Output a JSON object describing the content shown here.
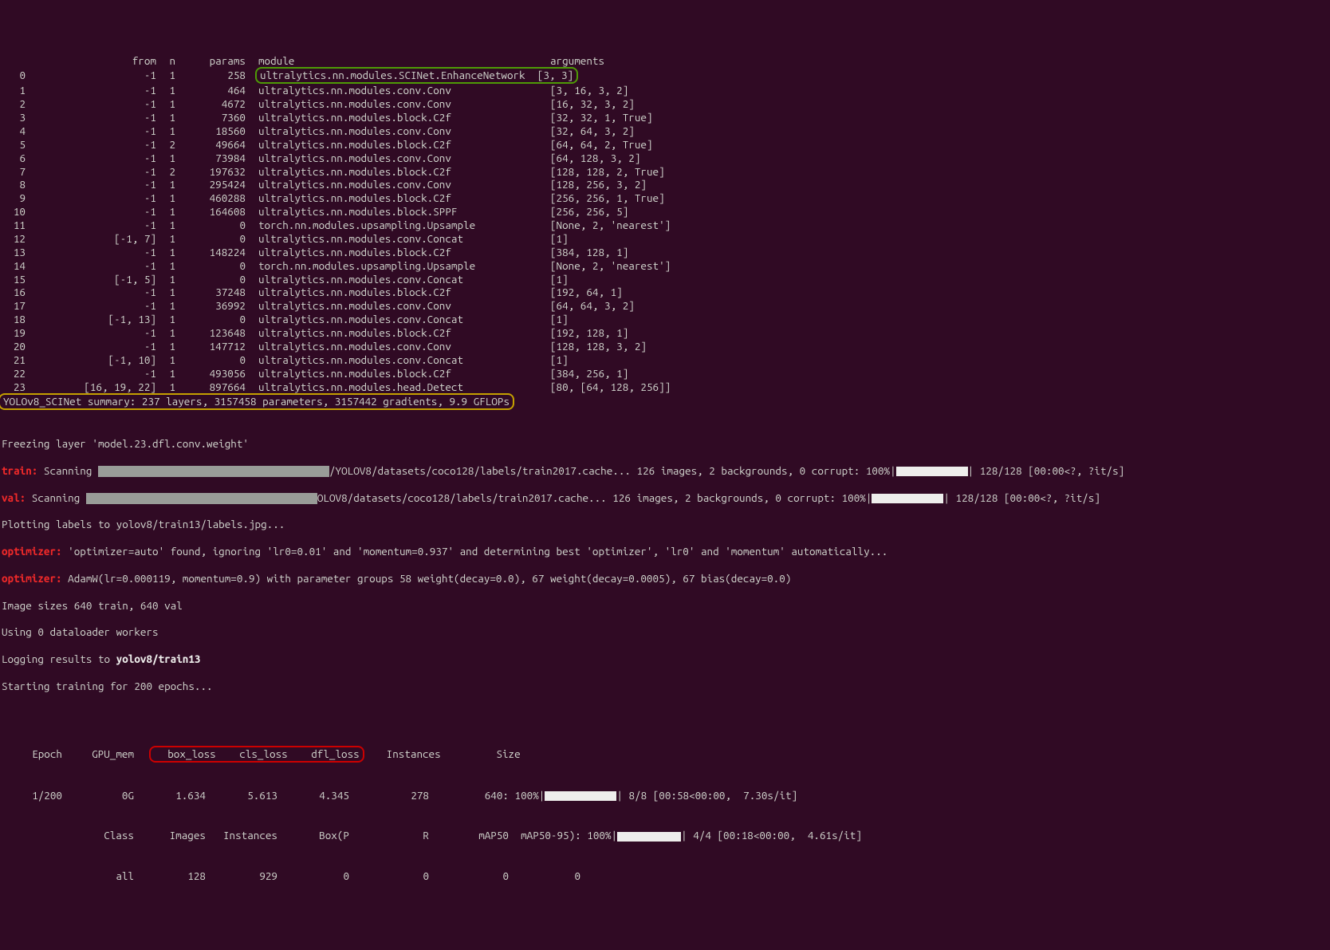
{
  "headers": {
    "from": "from",
    "n": "n",
    "params": "params",
    "module": "module",
    "arguments": "arguments"
  },
  "rows": [
    {
      "idx": "0",
      "from": "-1",
      "n": "1",
      "params": "258",
      "module": "ultralytics.nn.modules.SCINet.EnhanceNetwork",
      "args": "[3, 3]",
      "hl": "green"
    },
    {
      "idx": "1",
      "from": "-1",
      "n": "1",
      "params": "464",
      "module": "ultralytics.nn.modules.conv.Conv",
      "args": "[3, 16, 3, 2]"
    },
    {
      "idx": "2",
      "from": "-1",
      "n": "1",
      "params": "4672",
      "module": "ultralytics.nn.modules.conv.Conv",
      "args": "[16, 32, 3, 2]"
    },
    {
      "idx": "3",
      "from": "-1",
      "n": "1",
      "params": "7360",
      "module": "ultralytics.nn.modules.block.C2f",
      "args": "[32, 32, 1, True]"
    },
    {
      "idx": "4",
      "from": "-1",
      "n": "1",
      "params": "18560",
      "module": "ultralytics.nn.modules.conv.Conv",
      "args": "[32, 64, 3, 2]"
    },
    {
      "idx": "5",
      "from": "-1",
      "n": "2",
      "params": "49664",
      "module": "ultralytics.nn.modules.block.C2f",
      "args": "[64, 64, 2, True]"
    },
    {
      "idx": "6",
      "from": "-1",
      "n": "1",
      "params": "73984",
      "module": "ultralytics.nn.modules.conv.Conv",
      "args": "[64, 128, 3, 2]"
    },
    {
      "idx": "7",
      "from": "-1",
      "n": "2",
      "params": "197632",
      "module": "ultralytics.nn.modules.block.C2f",
      "args": "[128, 128, 2, True]"
    },
    {
      "idx": "8",
      "from": "-1",
      "n": "1",
      "params": "295424",
      "module": "ultralytics.nn.modules.conv.Conv",
      "args": "[128, 256, 3, 2]"
    },
    {
      "idx": "9",
      "from": "-1",
      "n": "1",
      "params": "460288",
      "module": "ultralytics.nn.modules.block.C2f",
      "args": "[256, 256, 1, True]"
    },
    {
      "idx": "10",
      "from": "-1",
      "n": "1",
      "params": "164608",
      "module": "ultralytics.nn.modules.block.SPPF",
      "args": "[256, 256, 5]"
    },
    {
      "idx": "11",
      "from": "-1",
      "n": "1",
      "params": "0",
      "module": "torch.nn.modules.upsampling.Upsample",
      "args": "[None, 2, 'nearest']"
    },
    {
      "idx": "12",
      "from": "[-1, 7]",
      "n": "1",
      "params": "0",
      "module": "ultralytics.nn.modules.conv.Concat",
      "args": "[1]"
    },
    {
      "idx": "13",
      "from": "-1",
      "n": "1",
      "params": "148224",
      "module": "ultralytics.nn.modules.block.C2f",
      "args": "[384, 128, 1]"
    },
    {
      "idx": "14",
      "from": "-1",
      "n": "1",
      "params": "0",
      "module": "torch.nn.modules.upsampling.Upsample",
      "args": "[None, 2, 'nearest']"
    },
    {
      "idx": "15",
      "from": "[-1, 5]",
      "n": "1",
      "params": "0",
      "module": "ultralytics.nn.modules.conv.Concat",
      "args": "[1]"
    },
    {
      "idx": "16",
      "from": "-1",
      "n": "1",
      "params": "37248",
      "module": "ultralytics.nn.modules.block.C2f",
      "args": "[192, 64, 1]"
    },
    {
      "idx": "17",
      "from": "-1",
      "n": "1",
      "params": "36992",
      "module": "ultralytics.nn.modules.conv.Conv",
      "args": "[64, 64, 3, 2]"
    },
    {
      "idx": "18",
      "from": "[-1, 13]",
      "n": "1",
      "params": "0",
      "module": "ultralytics.nn.modules.conv.Concat",
      "args": "[1]"
    },
    {
      "idx": "19",
      "from": "-1",
      "n": "1",
      "params": "123648",
      "module": "ultralytics.nn.modules.block.C2f",
      "args": "[192, 128, 1]"
    },
    {
      "idx": "20",
      "from": "-1",
      "n": "1",
      "params": "147712",
      "module": "ultralytics.nn.modules.conv.Conv",
      "args": "[128, 128, 3, 2]"
    },
    {
      "idx": "21",
      "from": "[-1, 10]",
      "n": "1",
      "params": "0",
      "module": "ultralytics.nn.modules.conv.Concat",
      "args": "[1]"
    },
    {
      "idx": "22",
      "from": "-1",
      "n": "1",
      "params": "493056",
      "module": "ultralytics.nn.modules.block.C2f",
      "args": "[384, 256, 1]"
    },
    {
      "idx": "23",
      "from": "[16, 19, 22]",
      "n": "1",
      "params": "897664",
      "module": "ultralytics.nn.modules.head.Detect",
      "args": "[80, [64, 128, 256]]"
    }
  ],
  "summary": "YOLOv8_SCINet summary: 237 layers, 3157458 parameters, 3157442 gradients, 9.9 GFLOPs",
  "freezing": "Freezing layer 'model.23.dfl.conv.weight'",
  "train_label": "train:",
  "val_label": "val:",
  "scan_word": " Scanning ",
  "train_scan_tail": "/YOLOV8/datasets/coco128/labels/train2017.cache... 126 images, 2 backgrounds, 0 corrupt: 100%|",
  "val_scan_tail": "OLOV8/datasets/coco128/labels/train2017.cache... 126 images, 2 backgrounds, 0 corrupt: 100%|",
  "scan_rhs": "| 128/128 [00:00<?, ?it/s]",
  "plotting": "Plotting labels to yolov8/train13/labels.jpg...",
  "opt_label": "optimizer:",
  "opt1": " 'optimizer=auto' found, ignoring 'lr0=0.01' and 'momentum=0.937' and determining best 'optimizer', 'lr0' and 'momentum' automatically...",
  "opt2": " AdamW(lr=0.000119, momentum=0.9) with parameter groups 58 weight(decay=0.0), 67 weight(decay=0.0005), 67 bias(decay=0.0)",
  "imgsizes": "Image sizes 640 train, 640 val",
  "workers": "Using 0 dataloader workers",
  "logging_pre": "Logging results to ",
  "logging_bold": "yolov8/train13",
  "starting": "Starting training for 200 epochs...",
  "ep_hdr": {
    "c1": "Epoch",
    "c2": "GPU_mem",
    "c3": "box_loss",
    "c4": "cls_loss",
    "c5": "dfl_loss",
    "c6": "Instances",
    "c7": "Size"
  },
  "ep_row1": {
    "c1": "1/200",
    "c2": "0G",
    "c3": "1.634",
    "c4": "5.613",
    "c5": "4.345",
    "c6": "278",
    "c7": "640:"
  },
  "ep_row1_tail_a": " 100%|",
  "ep_row1_tail_b": "| 8/8 [00:58<00:00,  7.30s/it]",
  "ep_hdr2": {
    "c1": "Class",
    "c2": "Images",
    "c3": "Instances",
    "c4": "Box(P",
    "c5": "R",
    "c6": "mAP50",
    "c7": "mAP50-95):"
  },
  "ep_row2_tail_a": " 100%|",
  "ep_row2_tail_b": "| 4/4 [00:18<00:00,  4.61s/it]",
  "ep_row3": {
    "c1": "all",
    "c2": "128",
    "c3": "929",
    "c4": "0",
    "c5": "0",
    "c6": "0",
    "c7": "0"
  }
}
